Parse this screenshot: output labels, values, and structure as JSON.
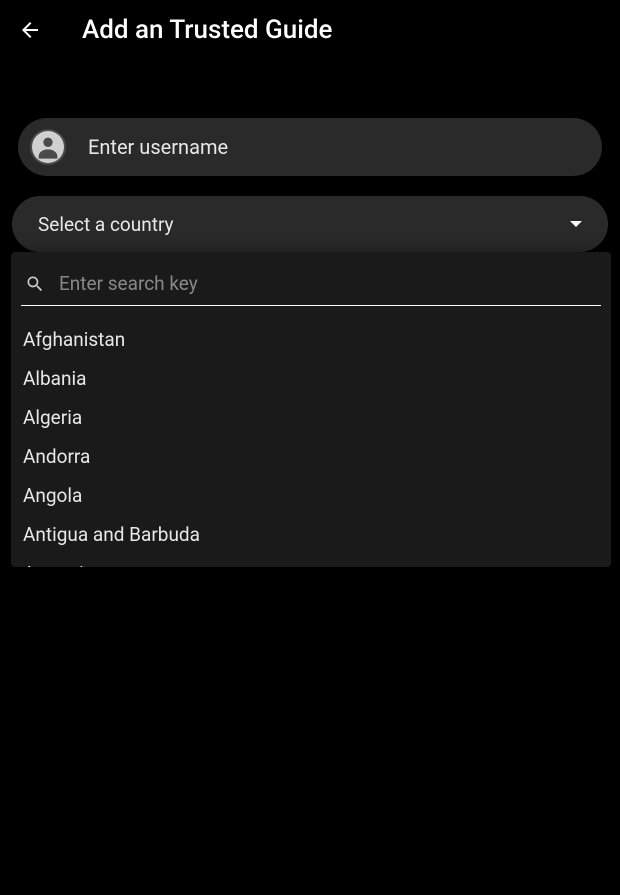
{
  "header": {
    "title": "Add an Trusted Guide"
  },
  "username": {
    "placeholder": "Enter username",
    "value": ""
  },
  "country_select": {
    "label": "Select a country"
  },
  "search": {
    "placeholder": "Enter search key",
    "value": ""
  },
  "countries": [
    "Afghanistan",
    "Albania",
    "Algeria",
    "Andorra",
    "Angola",
    "Antigua and Barbuda",
    "Argentina"
  ]
}
